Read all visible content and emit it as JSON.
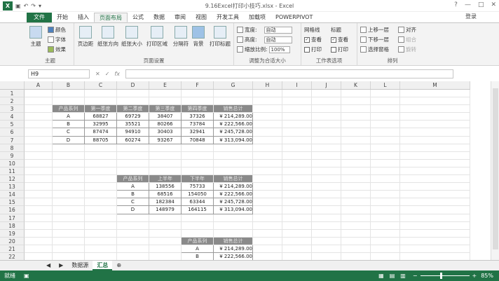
{
  "window": {
    "title": "9.16Excel打印小技巧.xlsx - Excel",
    "help": "?",
    "minimize": "—",
    "restore": "□",
    "close": "✕",
    "login": "登录"
  },
  "tabs": [
    "开始",
    "插入",
    "页面布局",
    "公式",
    "数据",
    "审阅",
    "视图",
    "开发工具",
    "加载项",
    "POWERPIVOT"
  ],
  "file_tab": "文件",
  "ribbon": {
    "theme_group": {
      "label": "主题",
      "theme": "主题",
      "colors": "颜色",
      "fonts": "字体",
      "effects": "效果"
    },
    "page_setup": {
      "label": "页面设置",
      "margins": "页边距",
      "orientation": "纸张方向",
      "size": "纸张大小",
      "print_area": "打印区域",
      "breaks": "分隔符",
      "background": "背景",
      "print_titles": "打印标题"
    },
    "scale": {
      "label": "调整为合适大小",
      "width": "宽度:",
      "width_val": "自动",
      "height": "高度:",
      "height_val": "自动",
      "scale": "缩放比例:",
      "scale_val": "100%"
    },
    "sheet_options": {
      "label": "工作表选项",
      "gridlines": "网格线",
      "headings": "标题",
      "view": "查看",
      "print": "打印"
    },
    "arrange": {
      "label": "排列",
      "bring_forward": "上移一层",
      "send_backward": "下移一层",
      "selection_pane": "选择窗格",
      "align": "对齐",
      "group": "组合",
      "rotate": "旋转"
    }
  },
  "formula_bar": {
    "name_box": "H9",
    "fx": "fx",
    "value": ""
  },
  "columns": [
    "A",
    "B",
    "C",
    "D",
    "E",
    "F",
    "G",
    "H",
    "I",
    "J",
    "K",
    "L",
    "M"
  ],
  "rows": [
    "1",
    "2",
    "3",
    "4",
    "5",
    "6",
    "7",
    "8",
    "9",
    "10",
    "11",
    "12",
    "13",
    "14",
    "15",
    "16",
    "17",
    "18",
    "19",
    "20",
    "21",
    "22"
  ],
  "table1": {
    "headers": [
      "产品系列",
      "第一季度",
      "第二季度",
      "第三季度",
      "第四季度",
      "销售总计"
    ],
    "data": [
      [
        "A",
        "68827",
        "69729",
        "38407",
        "37326",
        "¥ 214,289.00"
      ],
      [
        "B",
        "32995",
        "35521",
        "80266",
        "73784",
        "¥ 222,566.00"
      ],
      [
        "C",
        "87474",
        "94910",
        "30403",
        "32941",
        "¥ 245,728.00"
      ],
      [
        "D",
        "88705",
        "60274",
        "93267",
        "70848",
        "¥ 313,094.00"
      ]
    ]
  },
  "table2": {
    "headers": [
      "产品系列",
      "上半年",
      "下半年",
      "销售总计"
    ],
    "data": [
      [
        "A",
        "138556",
        "75733",
        "¥ 214,289.00"
      ],
      [
        "B",
        "68516",
        "154050",
        "¥ 222,566.00"
      ],
      [
        "C",
        "182384",
        "63344",
        "¥ 245,728.00"
      ],
      [
        "D",
        "148979",
        "164115",
        "¥ 313,094.00"
      ]
    ]
  },
  "table3": {
    "headers": [
      "产品系列",
      "销售总计"
    ],
    "data": [
      [
        "A",
        "¥ 214,289.00"
      ],
      [
        "B",
        "¥ 222,566.00"
      ]
    ]
  },
  "sheets": [
    "数据源",
    "汇总"
  ],
  "active_sheet": "汇总",
  "status": {
    "ready": "就绪",
    "zoom": "85%"
  },
  "colors": {
    "excel_green": "#217346",
    "table_header": "#8a8a8a"
  }
}
